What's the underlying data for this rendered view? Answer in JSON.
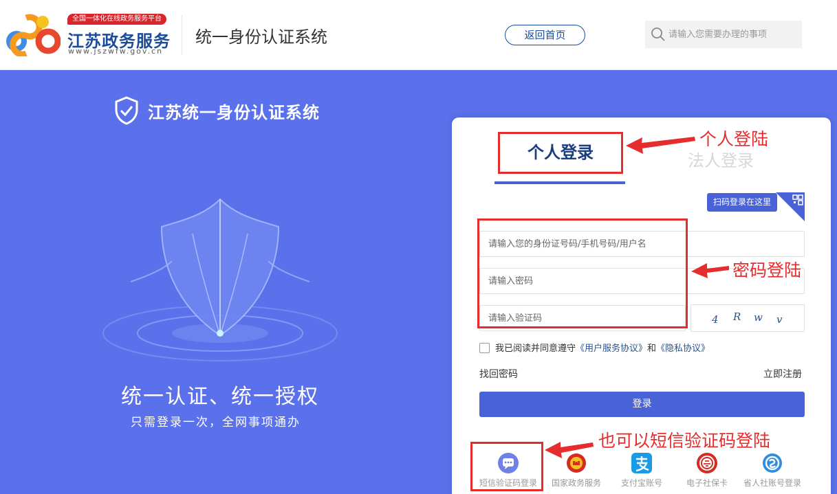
{
  "header": {
    "slogan": "全国一体化在线政务服务平台",
    "site_name": "江苏政务服务",
    "site_url": "www.jszwfw.gov.cn",
    "system_title": "统一身份认证系统",
    "home_button": "返回首页",
    "search_placeholder": "请输入您需要办理的事项"
  },
  "banner": {
    "title": "江苏统一身份认证系统",
    "slogan_main": "统一认证、统一授权",
    "slogan_sub": "只需登录一次，全网事项通办"
  },
  "login": {
    "tab_personal": "个人登录",
    "tab_legal": "法人登录",
    "qr_tip": "扫码登录在这里",
    "username_placeholder": "请输入您的身份证号码/手机号码/用户名",
    "password_placeholder": "请输入密码",
    "captcha_placeholder": "请输入验证码",
    "captcha_chars": [
      "4",
      "R",
      "w",
      "v"
    ],
    "agree_text": "我已阅读并同意遵守",
    "agree_link_service": "《用户服务协议》",
    "agree_and": "和",
    "agree_link_privacy": "《隐私协议》",
    "forgot_password": "找回密码",
    "register": "立即注册",
    "login_button": "登录"
  },
  "alt_logins": [
    {
      "label": "短信验证码登录",
      "icon": "sms-icon"
    },
    {
      "label": "国家政务服务平台账号登录",
      "icon": "national-emblem-icon"
    },
    {
      "label": "支付宝账号",
      "icon": "alipay-icon"
    },
    {
      "label": "电子社保卡",
      "icon": "social-security-card-icon"
    },
    {
      "label": "省人社账号登录",
      "icon": "hrss-account-icon"
    }
  ],
  "annotations": {
    "personal_login": "个人登陆",
    "password_login": "密码登陆",
    "sms_login": "也可以短信验证码登陆"
  },
  "colors": {
    "banner_bg": "#5b71eb",
    "primary": "#4a62d8",
    "brand_blue": "#1a4c9a",
    "annotation_red": "#e52d2d"
  }
}
